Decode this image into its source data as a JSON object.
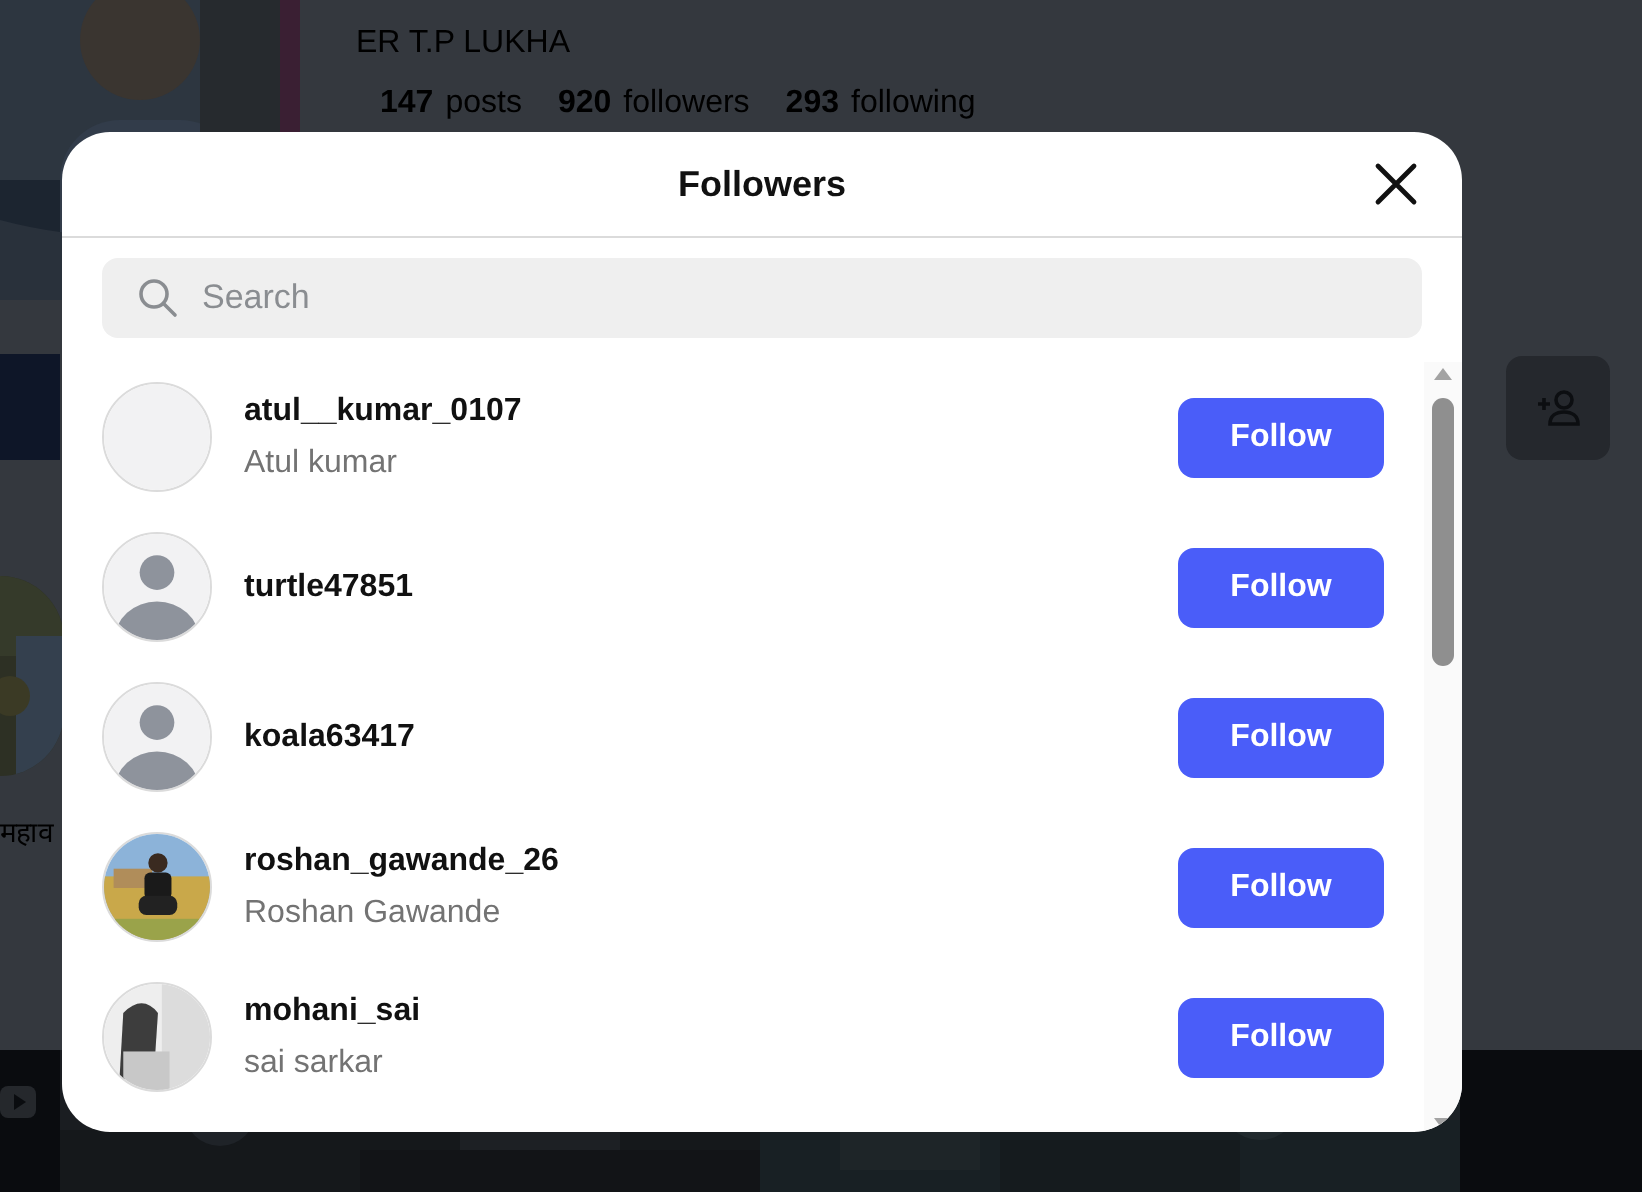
{
  "profile": {
    "subtitle": "ER T.P LUKHA",
    "stats": [
      {
        "count": "147",
        "label": "posts"
      },
      {
        "count": "920",
        "label": "followers"
      },
      {
        "count": "293",
        "label": "following"
      }
    ],
    "highlight_caption": "महाव"
  },
  "dialog": {
    "title": "Followers",
    "search": {
      "placeholder": "Search"
    },
    "followers": [
      {
        "username": "atul__kumar_0107",
        "full_name": "Atul kumar",
        "kind": "blank",
        "button": "Follow"
      },
      {
        "username": "turtle47851",
        "kind": "default",
        "button": "Follow"
      },
      {
        "username": "koala63417",
        "kind": "default",
        "button": "Follow"
      },
      {
        "username": "roshan_gawande_26",
        "full_name": "Roshan Gawande",
        "button": "Follow"
      },
      {
        "username": "mohani_sai",
        "full_name": "sai sarkar",
        "button": "Follow"
      }
    ]
  }
}
